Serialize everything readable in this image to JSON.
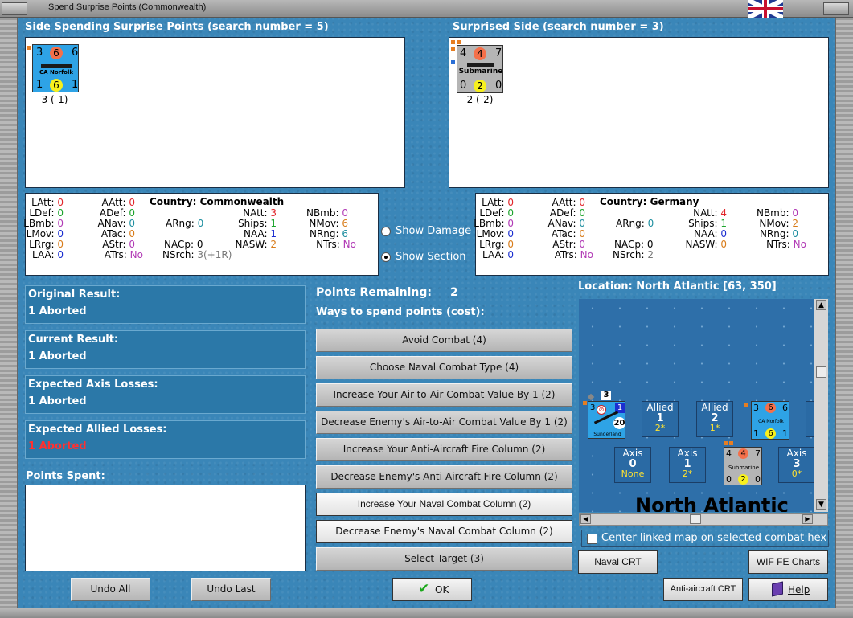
{
  "window": {
    "title": "Spend Surprise Points (Commonwealth)"
  },
  "left_side": {
    "header": "Side Spending Surprise Points (search number = 5)",
    "unit": {
      "name": "CA Norfolk",
      "top_left": "3",
      "top_mid": "6",
      "top_right": "6",
      "bot_left": "1",
      "bot_mid": "6",
      "bot_right": "1",
      "caption": "3 (-1)",
      "color": "#2ea3e6"
    },
    "stats": {
      "LAtt": "0",
      "LDef": "0",
      "LBmb": "0",
      "LMov": "0",
      "LRrg": "0",
      "LAA": "0",
      "AAtt": "0",
      "ADef": "0",
      "ANav": "0",
      "ATac": "0",
      "AStr": "0",
      "ATrs": "No",
      "country_label": "Country:",
      "country": "Commonwealth",
      "ARng": "0",
      "NACp": "0",
      "NSrch": "3(+1R)",
      "NAtt": "3",
      "Ships": "1",
      "NAA": "1",
      "NASW": "2",
      "NBmb": "0",
      "NMov": "6",
      "NRng": "6",
      "NTrs": "No"
    }
  },
  "right_side": {
    "header": "Surprised Side (search number = 3)",
    "unit": {
      "name": "Submarine",
      "top_left": "4",
      "top_mid": "4",
      "top_right": "7",
      "bot_left": "0",
      "bot_mid": "2",
      "bot_right": "0",
      "caption": "2 (-2)",
      "color": "#b5b5b5"
    },
    "stats": {
      "LAtt": "0",
      "LDef": "0",
      "LBmb": "0",
      "LMov": "0",
      "LRrg": "0",
      "LAA": "0",
      "AAtt": "0",
      "ADef": "0",
      "ANav": "0",
      "ATac": "0",
      "AStr": "0",
      "ATrs": "No",
      "country_label": "Country:",
      "country": "Germany",
      "ARng": "0",
      "NACp": "0",
      "NSrch": "2",
      "NAtt": "4",
      "Ships": "1",
      "NAA": "0",
      "NASW": "0",
      "NBmb": "0",
      "NMov": "2",
      "NRng": "0",
      "NTrs": "No"
    }
  },
  "stat_keys": {
    "LAtt": "LAtt:",
    "LDef": "LDef:",
    "LBmb": "LBmb:",
    "LMov": "LMov:",
    "LRrg": "LRrg:",
    "LAA": "LAA:",
    "AAtt": "AAtt:",
    "ADef": "ADef:",
    "ANav": "ANav:",
    "ATac": "ATac:",
    "AStr": "AStr:",
    "ATrs": "ATrs:",
    "ARng": "ARng:",
    "NACp": "NACp:",
    "NSrch": "NSrch:",
    "NAtt": "NAtt:",
    "Ships": "Ships:",
    "NAA": "NAA:",
    "NASW": "NASW:",
    "NBmb": "NBmb:",
    "NMov": "NMov:",
    "NRng": "NRng:",
    "NTrs": "NTrs:"
  },
  "options": {
    "show_damage": "Show Damage",
    "show_section": "Show Section",
    "selected": "show_section"
  },
  "results": {
    "original_label": "Original Result:",
    "original_value": "1 Aborted",
    "current_label": "Current Result:",
    "current_value": "1 Aborted",
    "axis_label": "Expected Axis Losses:",
    "axis_value": "1 Aborted",
    "allied_label": "Expected Allied Losses:",
    "allied_value": "1 Aborted",
    "spent_label": "Points Spent:"
  },
  "points": {
    "remaining_label": "Points Remaining:",
    "remaining_value": "2",
    "ways_label": "Ways to spend points (cost):"
  },
  "spend_options": [
    "Avoid Combat (4)",
    "Choose Naval Combat Type (4)",
    "Increase Your Air-to-Air Combat Value By 1 (2)",
    "Decrease Enemy's Air-to-Air Combat Value By 1 (2)",
    "Increase Your Anti-Aircraft Fire Column (2)",
    "Decrease Enemy's Anti-Aircraft Fire Column (2)",
    "Increase Your Naval Combat Column (2)",
    "Decrease Enemy's Naval Combat Column (2)",
    "Select Target (3)"
  ],
  "buttons": {
    "undo_all": "Undo All",
    "undo_last": "Undo Last",
    "ok": "OK",
    "naval_crt": "Naval CRT",
    "wif_charts": "WIF FE Charts",
    "aa_crt": "Anti-aircraft CRT",
    "help": "Help"
  },
  "map": {
    "location": "Location: North Atlantic [63, 350]",
    "sea_name": "North Atlantic",
    "center_linked": "Center linked map on selected combat hex",
    "allied_boxes": [
      {
        "side": "Allied",
        "value": "1",
        "sub": "2*"
      },
      {
        "side": "Allied",
        "value": "2",
        "sub": "1*"
      }
    ],
    "axis_boxes": [
      {
        "side": "Axis",
        "value": "0",
        "sub": "None"
      },
      {
        "side": "Axis",
        "value": "1",
        "sub": "2*"
      },
      {
        "side": "Axis",
        "value": "3",
        "sub": "0*"
      }
    ],
    "sunderland": {
      "name": "Sunderland",
      "a": "3",
      "b": "1",
      "c": "20",
      "stack": "3"
    },
    "norfolk_mini": {
      "name": "CA Norfolk",
      "tl": "3",
      "tm": "6",
      "tr": "6",
      "bl": "1",
      "bm": "6",
      "br": "1"
    },
    "sub_mini": {
      "name": "Submarine",
      "tl": "4",
      "tm": "4",
      "tr": "7",
      "bl": "0",
      "bm": "2",
      "br": "0"
    }
  }
}
